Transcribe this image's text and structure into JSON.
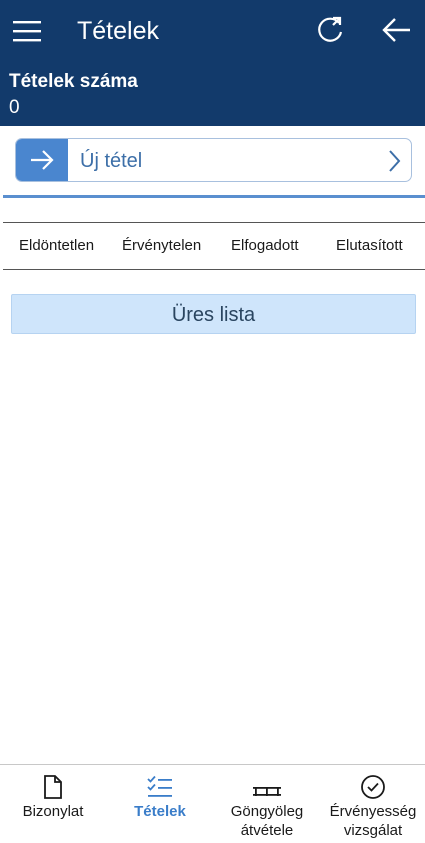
{
  "header": {
    "title": "Tételek",
    "menu_icon": "hamburger-menu-icon",
    "refresh_icon": "refresh-icon",
    "back_icon": "arrow-left-icon",
    "background": "#123a6b"
  },
  "summary": {
    "count_label": "Tételek száma",
    "count_value": "0"
  },
  "new_item": {
    "label": "Új tétel",
    "accent": "#4a86cf"
  },
  "filters": [
    "Eldöntetlen",
    "Érvénytelen",
    "Elfogadott",
    "Elutasított"
  ],
  "list": {
    "empty_text": "Üres lista"
  },
  "bottom_nav": {
    "items": [
      {
        "label": "Bizonylat",
        "icon": "document-icon",
        "active": false
      },
      {
        "label": "Tételek",
        "icon": "checklist-icon",
        "active": true
      },
      {
        "label": "Göngyöleg\nátvétele",
        "label_line1": "Göngyöleg",
        "label_line2": "átvétele",
        "icon": "pallet-icon",
        "active": false
      },
      {
        "label_line1": "Érvényesség",
        "label_line2": "vizsgálat",
        "icon": "check-circle-icon",
        "active": false
      }
    ],
    "active_color": "#3a7dc9"
  }
}
